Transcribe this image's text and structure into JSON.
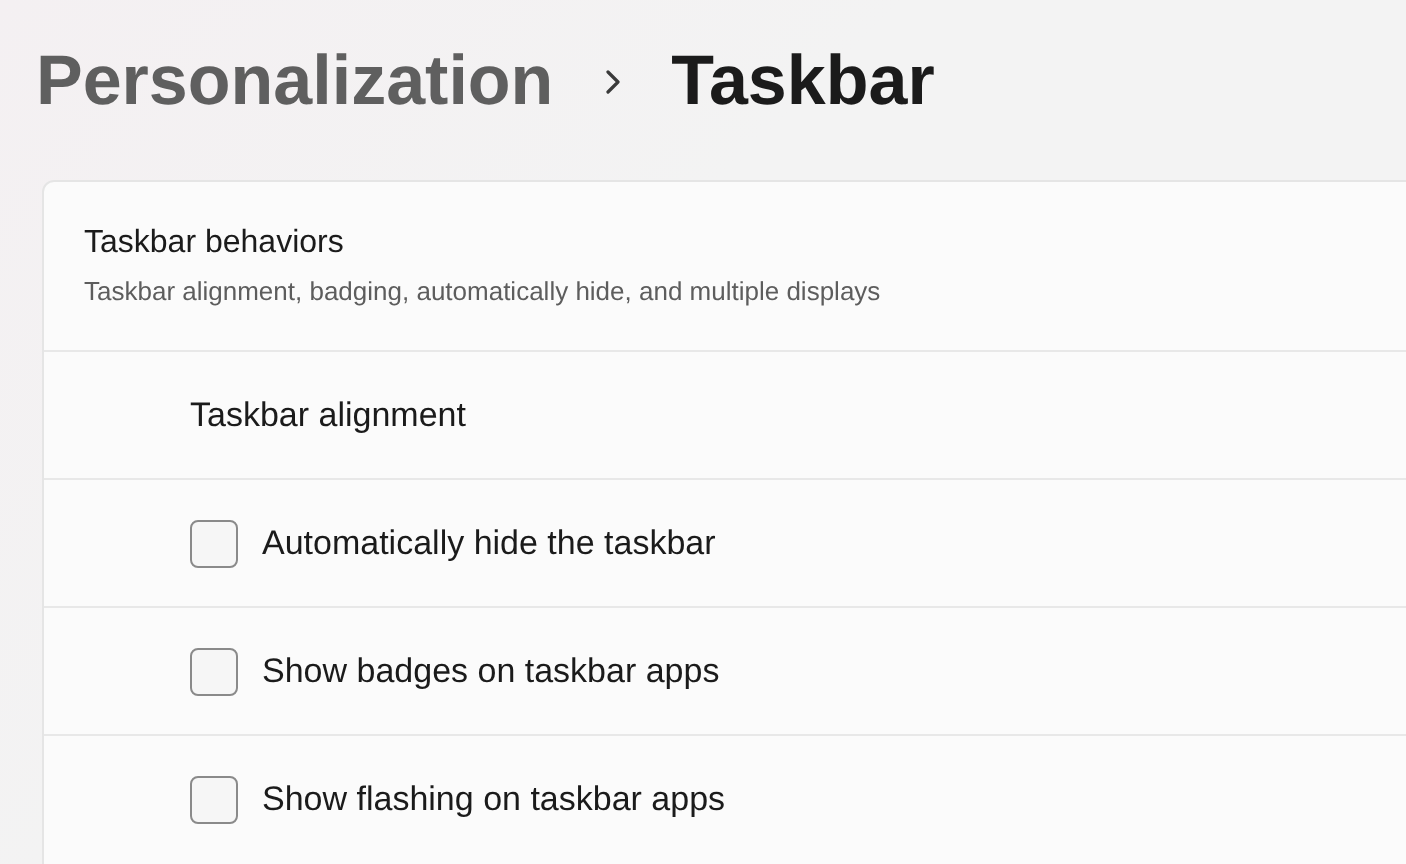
{
  "breadcrumb": {
    "parent": "Personalization",
    "current": "Taskbar"
  },
  "section": {
    "title": "Taskbar behaviors",
    "subtitle": "Taskbar alignment, badging, automatically hide, and multiple displays",
    "rows": [
      {
        "kind": "label",
        "label": "Taskbar alignment"
      },
      {
        "kind": "checkbox",
        "label": "Automatically hide the taskbar",
        "checked": false
      },
      {
        "kind": "checkbox",
        "label": "Show badges on taskbar apps",
        "checked": false
      },
      {
        "kind": "checkbox",
        "label": "Show flashing on taskbar apps",
        "checked": false
      }
    ]
  }
}
